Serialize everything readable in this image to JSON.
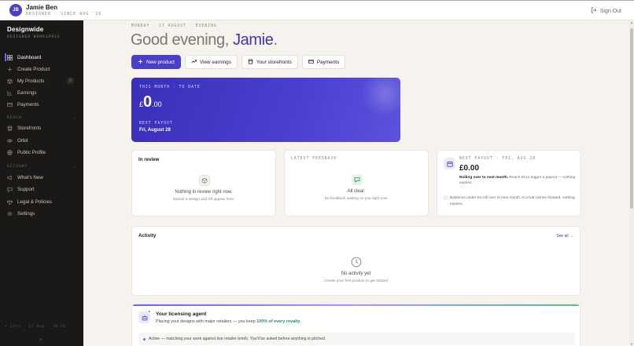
{
  "user": {
    "initials": "JB",
    "name": "Jamie Ben",
    "role": "DESIGNER · SINCE AUG '26",
    "signout_label": "Sign Out"
  },
  "sidebar": {
    "brand": "Designwide",
    "brand_sub": "DESIGNER WORKSPACE",
    "items": [
      {
        "label": "Dashboard",
        "icon": "dashboard-icon",
        "active": true
      },
      {
        "label": "Create Product",
        "icon": "plus-icon"
      },
      {
        "label": "My Products",
        "icon": "box-icon",
        "count": "0"
      },
      {
        "label": "Earnings",
        "icon": "chart-icon"
      },
      {
        "label": "Payments",
        "icon": "card-icon"
      }
    ],
    "reach_label": "REACH",
    "reach_items": [
      {
        "label": "Storefronts",
        "icon": "store-icon"
      },
      {
        "label": "Orbit",
        "icon": "orbit-icon"
      },
      {
        "label": "Public Profile",
        "icon": "globe-icon"
      }
    ],
    "account_label": "ACCOUNT",
    "account_items": [
      {
        "label": "What's New",
        "icon": "megaphone-icon"
      },
      {
        "label": "Support",
        "icon": "chat-icon"
      },
      {
        "label": "Legal & Policies",
        "icon": "scale-icon"
      },
      {
        "label": "Settings",
        "icon": "gear-icon"
      }
    ],
    "footer": "• Idle · 17 Aug · 20:38",
    "collapse_glyph": "«"
  },
  "main": {
    "dateline": "MONDAY · 17 AUGUST · EVENING",
    "greeting": "Good evening,",
    "greeting_name": "Jamie",
    "greeting_end": ".",
    "actions": [
      {
        "label": "New product",
        "icon": "plus-icon",
        "primary": true
      },
      {
        "label": "View earnings",
        "icon": "trend-icon"
      },
      {
        "label": "Your storefronts",
        "icon": "store-icon"
      },
      {
        "label": "Payments",
        "icon": "card-icon"
      }
    ],
    "hero": {
      "label": "THIS MONTH · TO DATE",
      "currency": "£",
      "amount_int": "0",
      "amount_dec": ".00",
      "next_payout_label": "NEXT PAYOUT",
      "next_payout_date": "Fri, August 28"
    },
    "in_review": {
      "title": "In review",
      "empty_main": "Nothing in review right now.",
      "empty_sub": "Submit a design and it'll appear here."
    },
    "feedback": {
      "title": "LATEST FEEDBACK",
      "empty_main": "All clear.",
      "empty_sub": "No feedback waiting on you right now."
    },
    "next_payout": {
      "label": "NEXT PAYOUT · FRI, AUG 28",
      "amount": "£0.00",
      "note_bold": "Rolling over to next month.",
      "note_rest": " Reach £5 to trigger a payout — nothing expires.",
      "foot": "Balances under £5 roll over to next month. Accrual carries forward, nothing expires."
    },
    "activity": {
      "title": "Activity",
      "see_all": "See all →",
      "empty_main": "No activity yet",
      "empty_sub": "Create your first product to get started"
    },
    "agent": {
      "title": "Your licensing agent",
      "desc_pre": "Placing your designs with major retailers — you keep ",
      "desc_hl": "100% of every royalty",
      "desc_post": ".",
      "status": "Active — matching your work against live retailer briefs. You'll be asked before anything is pitched."
    }
  },
  "colors": {
    "accent": "#4a3fc8",
    "sidebar_bg": "#1a1918",
    "page_bg": "#f6f3ee",
    "success": "#2f8d5c"
  }
}
